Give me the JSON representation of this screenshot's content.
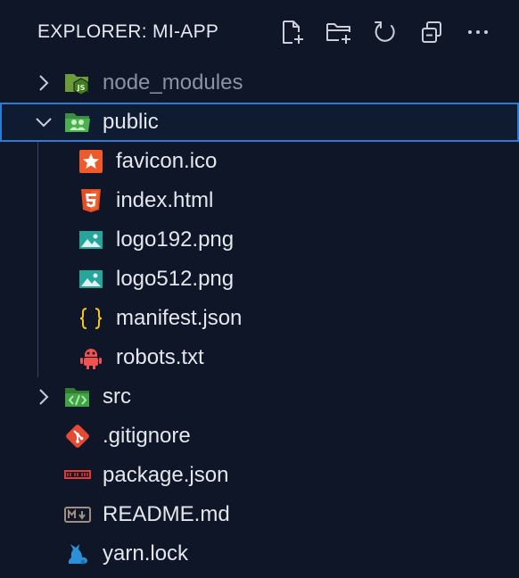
{
  "explorer": {
    "title": "EXPLORER: MI-APP",
    "actions": [
      {
        "name": "new-file-icon"
      },
      {
        "name": "new-folder-icon"
      },
      {
        "name": "refresh-icon"
      },
      {
        "name": "collapse-all-icon"
      },
      {
        "name": "more-actions-icon"
      }
    ]
  },
  "tree": {
    "node_modules": {
      "label": "node_modules",
      "icon": "nodejs-folder-icon",
      "expanded": false
    },
    "public": {
      "label": "public",
      "icon": "public-folder-icon",
      "expanded": true,
      "selected": true
    },
    "public_children": [
      {
        "label": "favicon.ico",
        "icon": "favicon-icon"
      },
      {
        "label": "index.html",
        "icon": "html5-icon"
      },
      {
        "label": "logo192.png",
        "icon": "image-icon"
      },
      {
        "label": "logo512.png",
        "icon": "image-icon"
      },
      {
        "label": "manifest.json",
        "icon": "json-braces-icon"
      },
      {
        "label": "robots.txt",
        "icon": "robot-icon"
      }
    ],
    "src": {
      "label": "src",
      "icon": "src-folder-icon",
      "expanded": false
    },
    "root_files": [
      {
        "label": ".gitignore",
        "icon": "git-icon"
      },
      {
        "label": "package.json",
        "icon": "npm-icon"
      },
      {
        "label": "README.md",
        "icon": "markdown-icon"
      },
      {
        "label": "yarn.lock",
        "icon": "yarn-cat-icon"
      }
    ]
  },
  "colors": {
    "background": "#0e1628",
    "selection_border": "#2b7bd5",
    "text": "#e4e7ed",
    "dim_text": "#8a92a3"
  }
}
